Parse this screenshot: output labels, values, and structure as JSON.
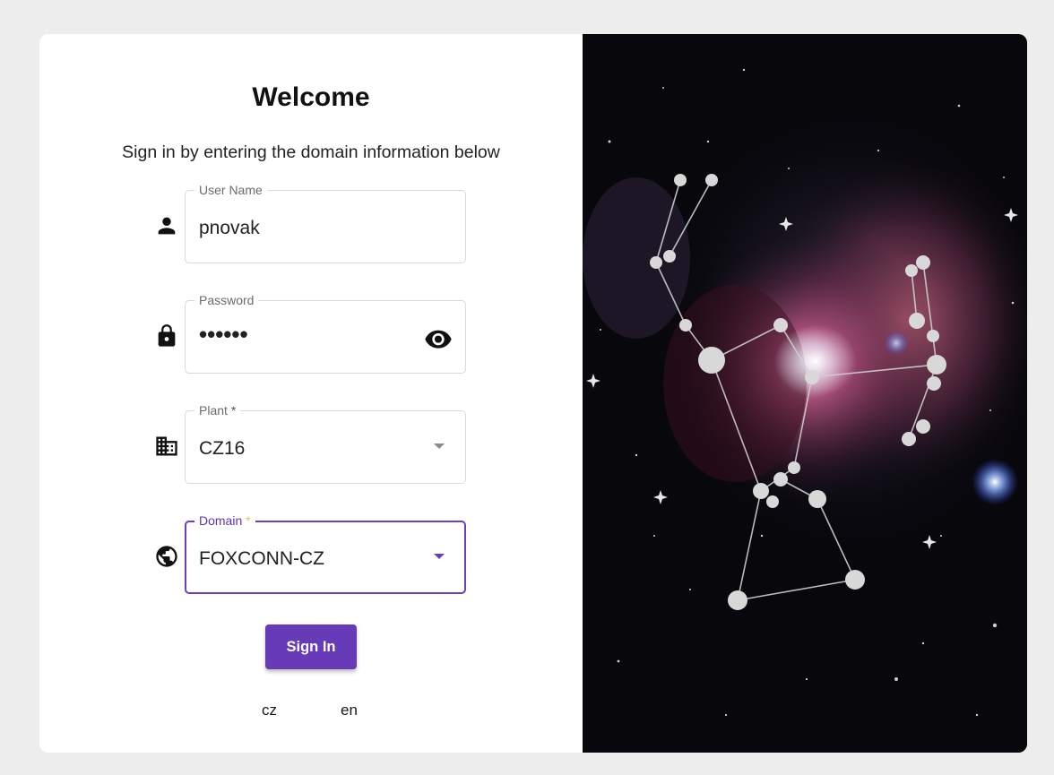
{
  "welcome": {
    "title": "Welcome",
    "subtitle": "Sign in by entering the domain information below"
  },
  "form": {
    "username": {
      "label": "User Name",
      "value": "pnovak",
      "icon": "person-icon"
    },
    "password": {
      "label": "Password",
      "value": "••••••",
      "icon": "lock-icon",
      "toggle_icon": "eye-icon"
    },
    "plant": {
      "label": "Plant",
      "required_mark": "*",
      "value": "CZ16",
      "icon": "building-icon"
    },
    "domain": {
      "label": "Domain",
      "required_mark": "*",
      "value": "FOXCONN-CZ",
      "icon": "globe-icon"
    },
    "submit_label": "Sign In"
  },
  "languages": [
    "cz",
    "en"
  ],
  "colors": {
    "accent": "#673ab7",
    "focus_border": "#6a3fbf",
    "page_bg": "#ededed"
  }
}
